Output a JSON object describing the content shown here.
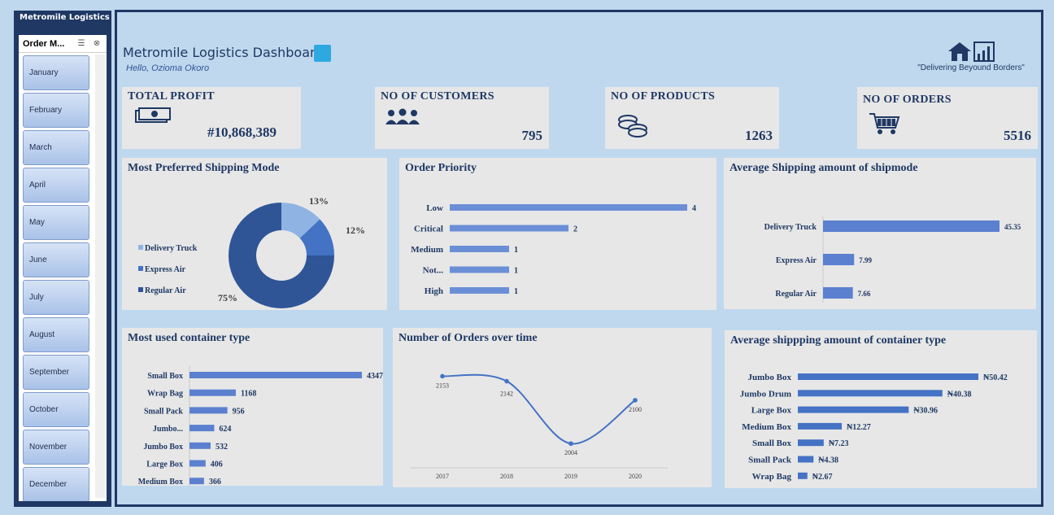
{
  "sidebar": {
    "title": "Metromile Logistics",
    "slicer_title": "Order M...",
    "months": [
      "January",
      "February",
      "March",
      "April",
      "May",
      "June",
      "July",
      "August",
      "September",
      "October",
      "November",
      "December"
    ]
  },
  "header": {
    "title": "Metromile Logistics Dashboard",
    "greeting": "Hello, Ozioma Okoro",
    "tagline": "\"Delivering Beyound Borders\""
  },
  "kpis": {
    "profit": {
      "label": "TOTAL PROFIT",
      "value": "#10,868,389"
    },
    "customers": {
      "label": "NO OF CUSTOMERS",
      "value": "795"
    },
    "products": {
      "label": "NO OF PRODUCTS",
      "value": "1263"
    },
    "orders": {
      "label": "NO OF ORDERS",
      "value": "5516"
    }
  },
  "colors": {
    "navy": "#1f3864",
    "bar": "#4472c4",
    "bar_light": "#6b8fd6",
    "bg": "#bfd8ee",
    "card": "#e7e7e7"
  },
  "chart_data": [
    {
      "id": "shipping_mode",
      "type": "pie",
      "title": "Most Preferred Shipping Mode",
      "categories": [
        "Delivery Truck",
        "Express Air",
        "Regular Air"
      ],
      "values": [
        13,
        12,
        75
      ],
      "value_labels": [
        "13%",
        "12%",
        "75%"
      ],
      "colors": [
        "#8fb4e3",
        "#4472c4",
        "#2f5597"
      ],
      "legend": "left"
    },
    {
      "id": "order_priority",
      "type": "bar",
      "title": "Order Priority",
      "categories": [
        "Low",
        "Critical",
        "Medium",
        "Not...",
        "High"
      ],
      "values": [
        4,
        2,
        1,
        1,
        1
      ]
    },
    {
      "id": "avg_ship_mode",
      "type": "bar",
      "title": "Average Shipping amount of shipmode",
      "categories": [
        "Delivery Truck",
        "Express Air",
        "Regular Air"
      ],
      "values": [
        45.35,
        7.99,
        7.66
      ],
      "value_labels": [
        "45.35",
        "7.99",
        "7.66"
      ]
    },
    {
      "id": "container_type",
      "type": "bar",
      "title": "Most used container type",
      "categories": [
        "Small Box",
        "Wrap Bag",
        "Small Pack",
        "Jumbo...",
        "Jumbo Box",
        "Large Box",
        "Medium Box"
      ],
      "values": [
        4347,
        1168,
        956,
        624,
        532,
        406,
        366
      ]
    },
    {
      "id": "orders_over_time",
      "type": "line",
      "title": "Number of Orders over time",
      "x": [
        "2017",
        "2018",
        "2019",
        "2020"
      ],
      "values": [
        2153,
        2142,
        2004,
        2100
      ]
    },
    {
      "id": "avg_container",
      "type": "bar",
      "title": "Average shippping amount of container type",
      "categories": [
        "Jumbo Box",
        "Jumbo Drum",
        "Large Box",
        "Medium Box",
        "Small Box",
        "Small Pack",
        "Wrap Bag"
      ],
      "values": [
        50.42,
        40.38,
        30.96,
        12.27,
        7.23,
        4.38,
        2.67
      ],
      "value_labels": [
        "₦50.42",
        "₦40.38",
        "₦30.96",
        "₦12.27",
        "₦7.23",
        "₦4.38",
        "₦2.67"
      ]
    }
  ]
}
